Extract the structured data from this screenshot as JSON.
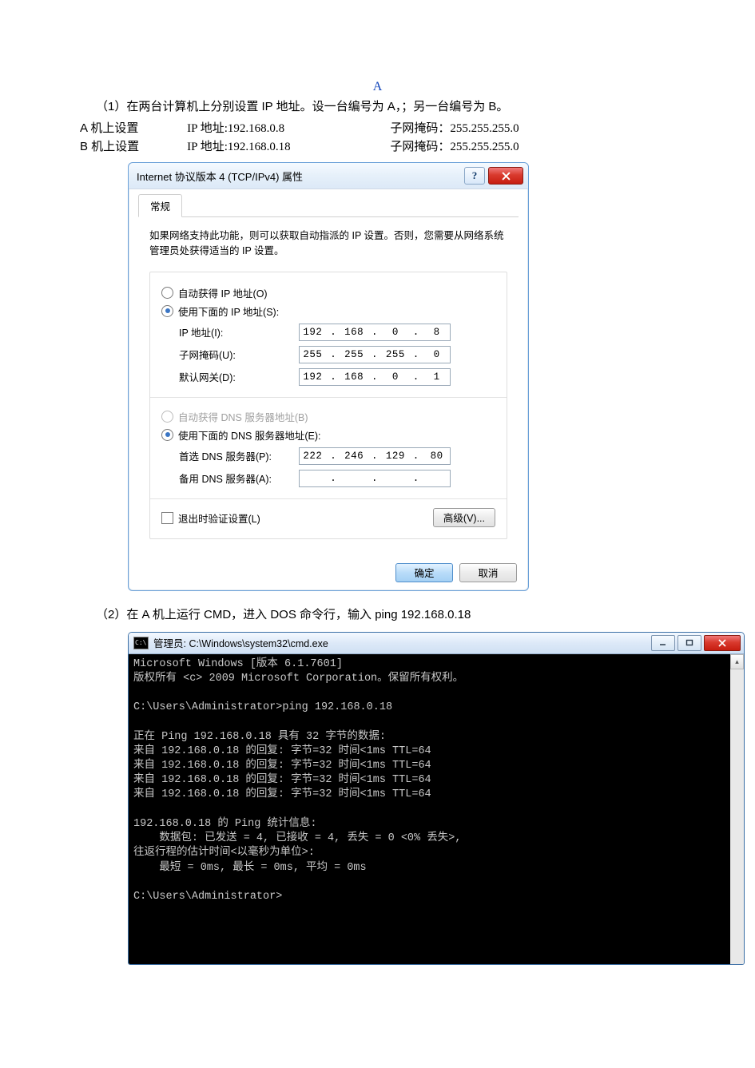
{
  "header": {
    "section_letter": "A"
  },
  "intro1": "（1）在两台计算机上分别设置 IP 地址。设一台编号为 A，；另一台编号为 B。",
  "settings_rows": [
    {
      "host": "A 机上设置",
      "ip_label": "IP 地址:192.168.0.8",
      "mask_label": "子网掩码：255.255.255.0"
    },
    {
      "host": "B 机上设置",
      "ip_label": "IP 地址:192.168.0.18",
      "mask_label": "子网掩码：255.255.255.0"
    }
  ],
  "dialog": {
    "title": "Internet 协议版本 4 (TCP/IPv4) 属性",
    "tab": "常规",
    "description": "如果网络支持此功能，则可以获取自动指派的 IP 设置。否则，您需要从网络系统管理员处获得适当的 IP 设置。",
    "radio_auto_ip": "自动获得 IP 地址(O)",
    "radio_manual_ip": "使用下面的 IP 地址(S):",
    "label_ip": "IP 地址(I):",
    "label_mask": "子网掩码(U):",
    "label_gateway": "默认网关(D):",
    "ip_value": [
      "192",
      "168",
      "0",
      "8"
    ],
    "mask_value": [
      "255",
      "255",
      "255",
      "0"
    ],
    "gateway_value": [
      "192",
      "168",
      "0",
      "1"
    ],
    "radio_auto_dns": "自动获得 DNS 服务器地址(B)",
    "radio_manual_dns": "使用下面的 DNS 服务器地址(E):",
    "label_dns1": "首选 DNS 服务器(P):",
    "label_dns2": "备用 DNS 服务器(A):",
    "dns1_value": [
      "222",
      "246",
      "129",
      "80"
    ],
    "dns2_value": [
      "",
      "",
      "",
      ""
    ],
    "checkbox_validate": "退出时验证设置(L)",
    "advanced_btn": "高级(V)...",
    "ok_btn": "确定",
    "cancel_btn": "取消"
  },
  "intro2": "（2）在 A 机上运行 CMD，进入 DOS 命令行，输入 ping 192.168.0.18",
  "cmd": {
    "title": "管理员: C:\\Windows\\system32\\cmd.exe",
    "lines": [
      "Microsoft Windows [版本 6.1.7601]",
      "版权所有 <c> 2009 Microsoft Corporation。保留所有权利。",
      "",
      "C:\\Users\\Administrator>ping 192.168.0.18",
      "",
      "正在 Ping 192.168.0.18 具有 32 字节的数据:",
      "来自 192.168.0.18 的回复: 字节=32 时间<1ms TTL=64",
      "来自 192.168.0.18 的回复: 字节=32 时间<1ms TTL=64",
      "来自 192.168.0.18 的回复: 字节=32 时间<1ms TTL=64",
      "来自 192.168.0.18 的回复: 字节=32 时间<1ms TTL=64",
      "",
      "192.168.0.18 的 Ping 统计信息:",
      "    数据包: 已发送 = 4, 已接收 = 4, 丢失 = 0 <0% 丢失>,",
      "往返行程的估计时间<以毫秒为单位>:",
      "    最短 = 0ms, 最长 = 0ms, 平均 = 0ms",
      "",
      "C:\\Users\\Administrator>"
    ]
  }
}
